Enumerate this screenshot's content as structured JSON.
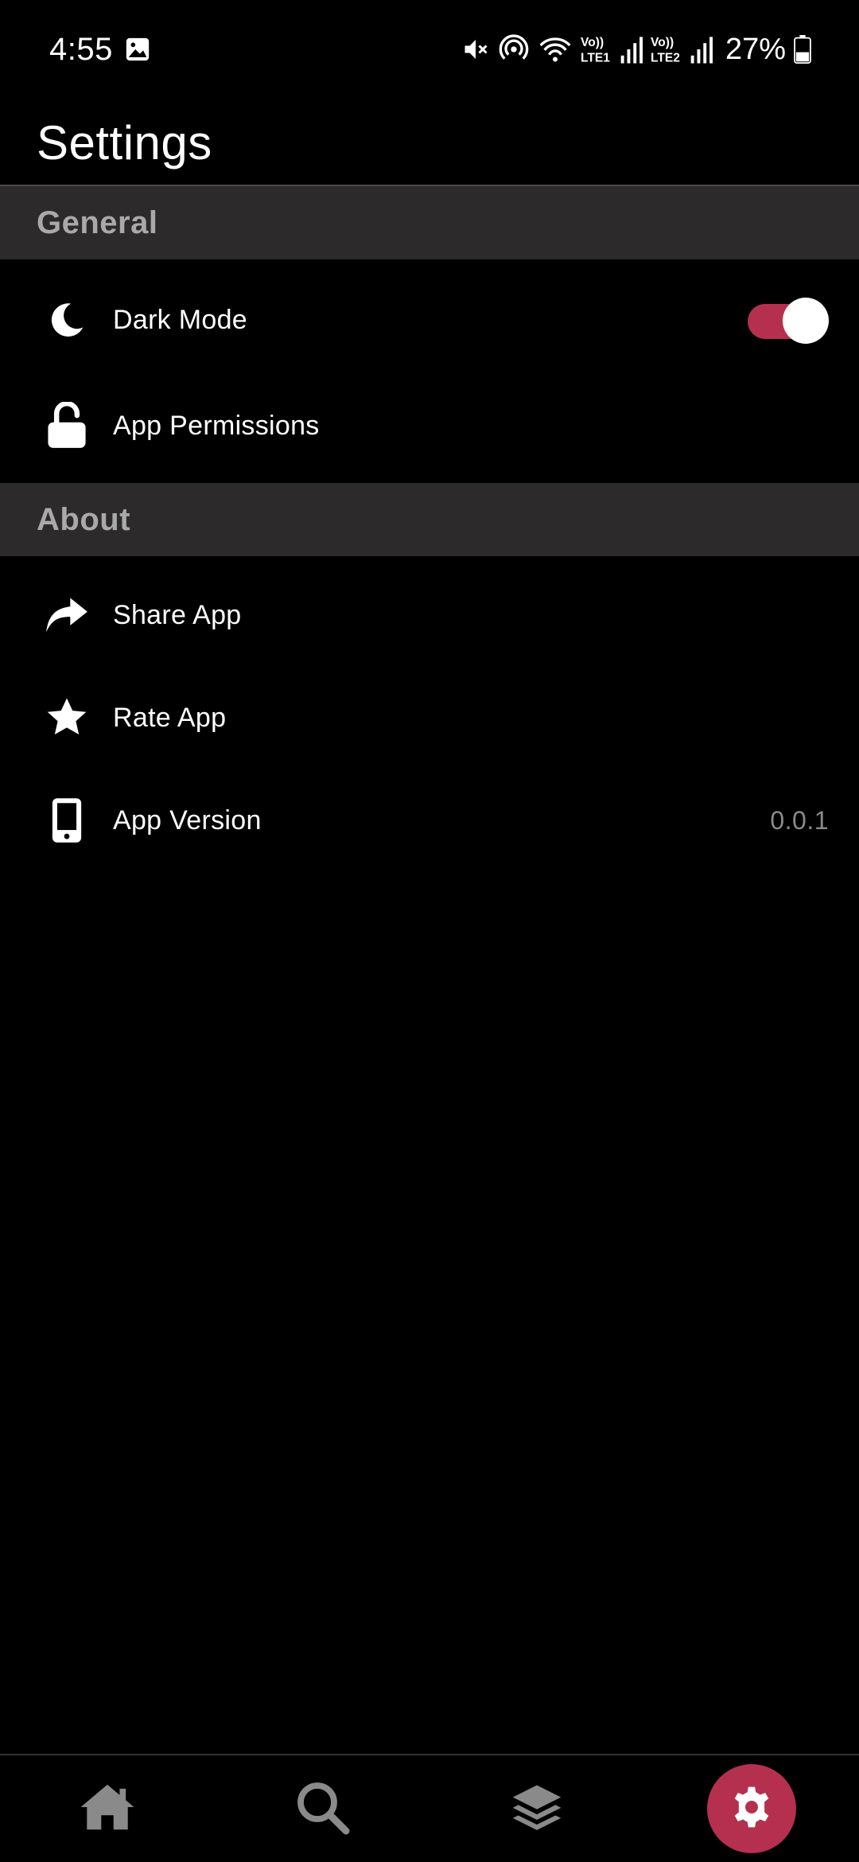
{
  "status_bar": {
    "time": "4:55",
    "network_1": "Vo) LTE1",
    "network_2": "Vo) LTE2",
    "battery": "27%"
  },
  "header": {
    "title": "Settings"
  },
  "sections": {
    "general": {
      "title": "General",
      "dark_mode_label": "Dark Mode",
      "dark_mode_enabled": true,
      "permissions_label": "App Permissions"
    },
    "about": {
      "title": "About",
      "share_label": "Share App",
      "rate_label": "Rate App",
      "version_label": "App Version",
      "version_value": "0.0.1"
    }
  },
  "bottom_nav": {
    "items": [
      {
        "icon": "home-icon",
        "active": false
      },
      {
        "icon": "search-icon",
        "active": false
      },
      {
        "icon": "layers-icon",
        "active": false
      },
      {
        "icon": "gear-icon",
        "active": true
      }
    ]
  },
  "colors": {
    "background": "#000000",
    "section_bg": "#2c2a2b",
    "accent": "#b5304f",
    "section_text": "#a9a9a9",
    "inactive_icon": "#8a8a8a"
  }
}
